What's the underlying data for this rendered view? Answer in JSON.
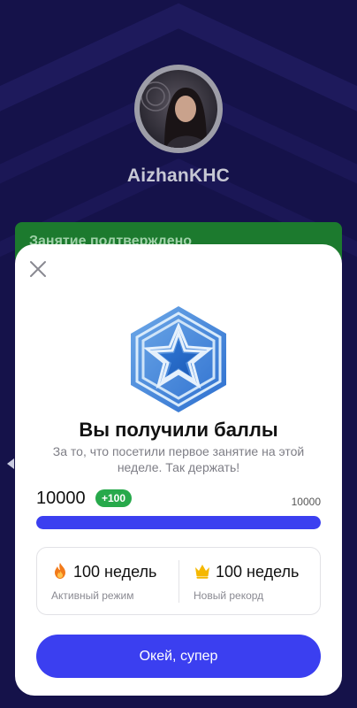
{
  "profile": {
    "username": "AizhanKHC"
  },
  "toast": {
    "text": "Занятие подтверждено"
  },
  "dialog": {
    "title": "Вы получили баллы",
    "subtitle": "За то, что посетили первое занятие на этой неделе. Так держать!",
    "points": "10000",
    "points_delta": "+100",
    "points_target": "10000",
    "progress_fraction": 1.0,
    "stats": {
      "active": {
        "value": "100 недель",
        "label": "Активный режим",
        "icon": "fire-icon"
      },
      "record": {
        "value": "100 недель",
        "label": "Новый рекорд",
        "icon": "crown-icon"
      }
    },
    "ok_label": "Окей, супер"
  },
  "colors": {
    "background": "#15124a",
    "accent": "#3b3ff0",
    "success": "#27a94b",
    "toast": "#1c7a2e"
  }
}
